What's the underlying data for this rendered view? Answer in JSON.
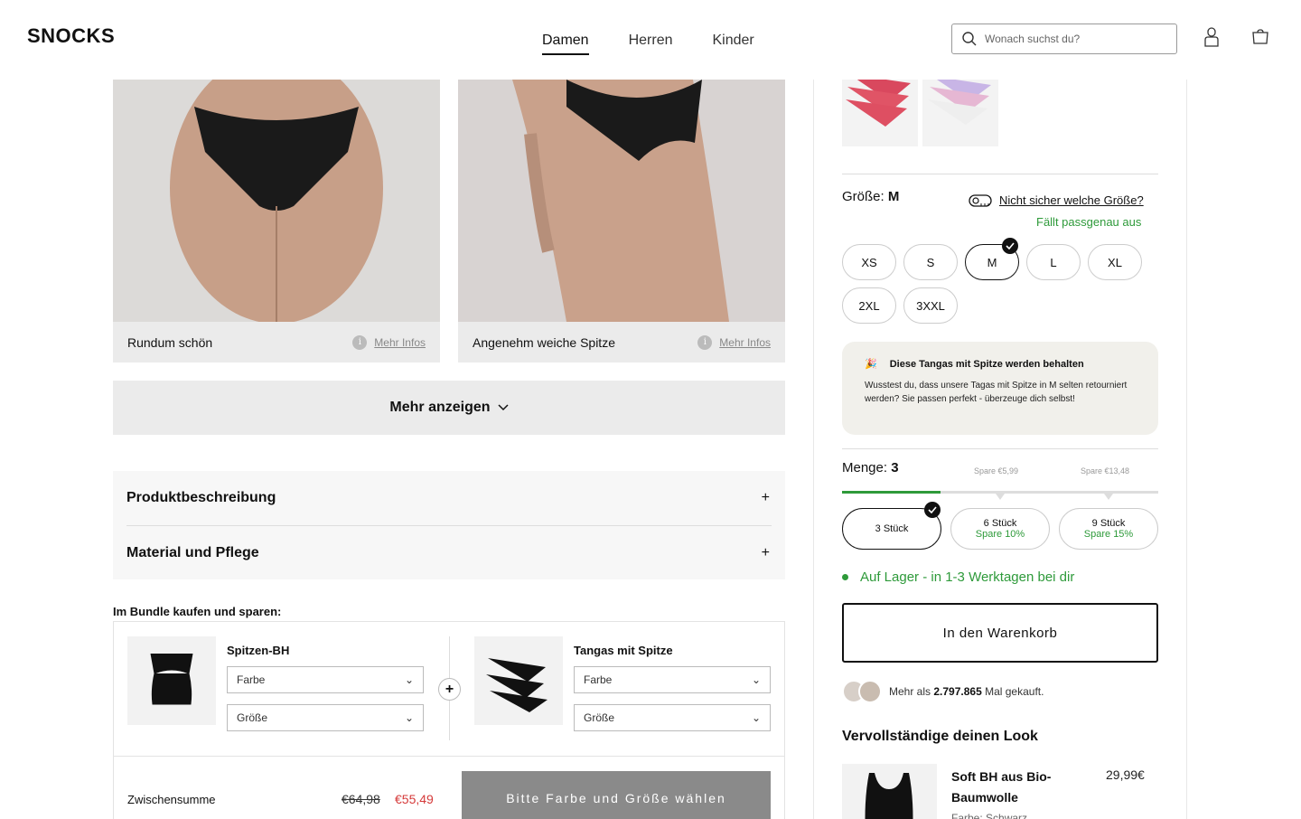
{
  "brand": "SNOCKS",
  "nav": [
    "Damen",
    "Herren",
    "Kinder"
  ],
  "search": {
    "placeholder": "Wonach suchst du?"
  },
  "gallery": [
    {
      "caption": "Rundum schön",
      "info": "Mehr Infos"
    },
    {
      "caption": "Angenehm weiche Spitze",
      "info": "Mehr Infos"
    }
  ],
  "more_button": "Mehr anzeigen",
  "accordion": [
    "Produktbeschreibung",
    "Material und Pflege"
  ],
  "bundle": {
    "title": "Im Bundle kaufen und sparen:",
    "items": [
      {
        "name": "Spitzen-BH",
        "color": "Farbe",
        "size": "Größe"
      },
      {
        "name": "Tangas mit Spitze",
        "color": "Farbe",
        "size": "Größe"
      }
    ],
    "subtotal_label": "Zwischensumme",
    "old_price": "€64,98",
    "new_price": "€55,49",
    "cta": "Bitte Farbe und Größe wählen"
  },
  "size": {
    "label": "Größe:",
    "selected": "M",
    "help": "Nicht sicher welche Größe?",
    "fit": "Fällt passgenau aus",
    "options": [
      "XS",
      "S",
      "M",
      "L",
      "XL",
      "2XL",
      "3XXL"
    ]
  },
  "notice": {
    "title": "Diese Tangas mit Spitze werden behalten",
    "text": "Wusstest du, dass unsere Tagas mit Spitze in M selten retourniert werden? Sie passen perfekt - überzeuge dich selbst!"
  },
  "quantity": {
    "label": "Menge:",
    "value": "3",
    "save_labels": [
      "Spare €5,99",
      "Spare €13,48"
    ],
    "options": [
      {
        "label": "3 Stück",
        "save": ""
      },
      {
        "label": "6 Stück",
        "save": "Spare  10%"
      },
      {
        "label": "9 Stück",
        "save": "Spare  15%"
      }
    ]
  },
  "stock": "Auf Lager - in 1-3 Werktagen bei dir",
  "cart_button": "In den Warenkorb",
  "social": {
    "prefix": "Mehr als ",
    "count": "2.797.865",
    "suffix": " Mal gekauft."
  },
  "look": {
    "title": "Vervollständige deinen Look",
    "product": "Soft BH aus Bio-Baumwolle",
    "price": "29,99€",
    "sub": "Farbe: Schwarz"
  },
  "colors": {
    "accent_green": "#2e9a3a",
    "sale_red": "#d53a3a"
  }
}
